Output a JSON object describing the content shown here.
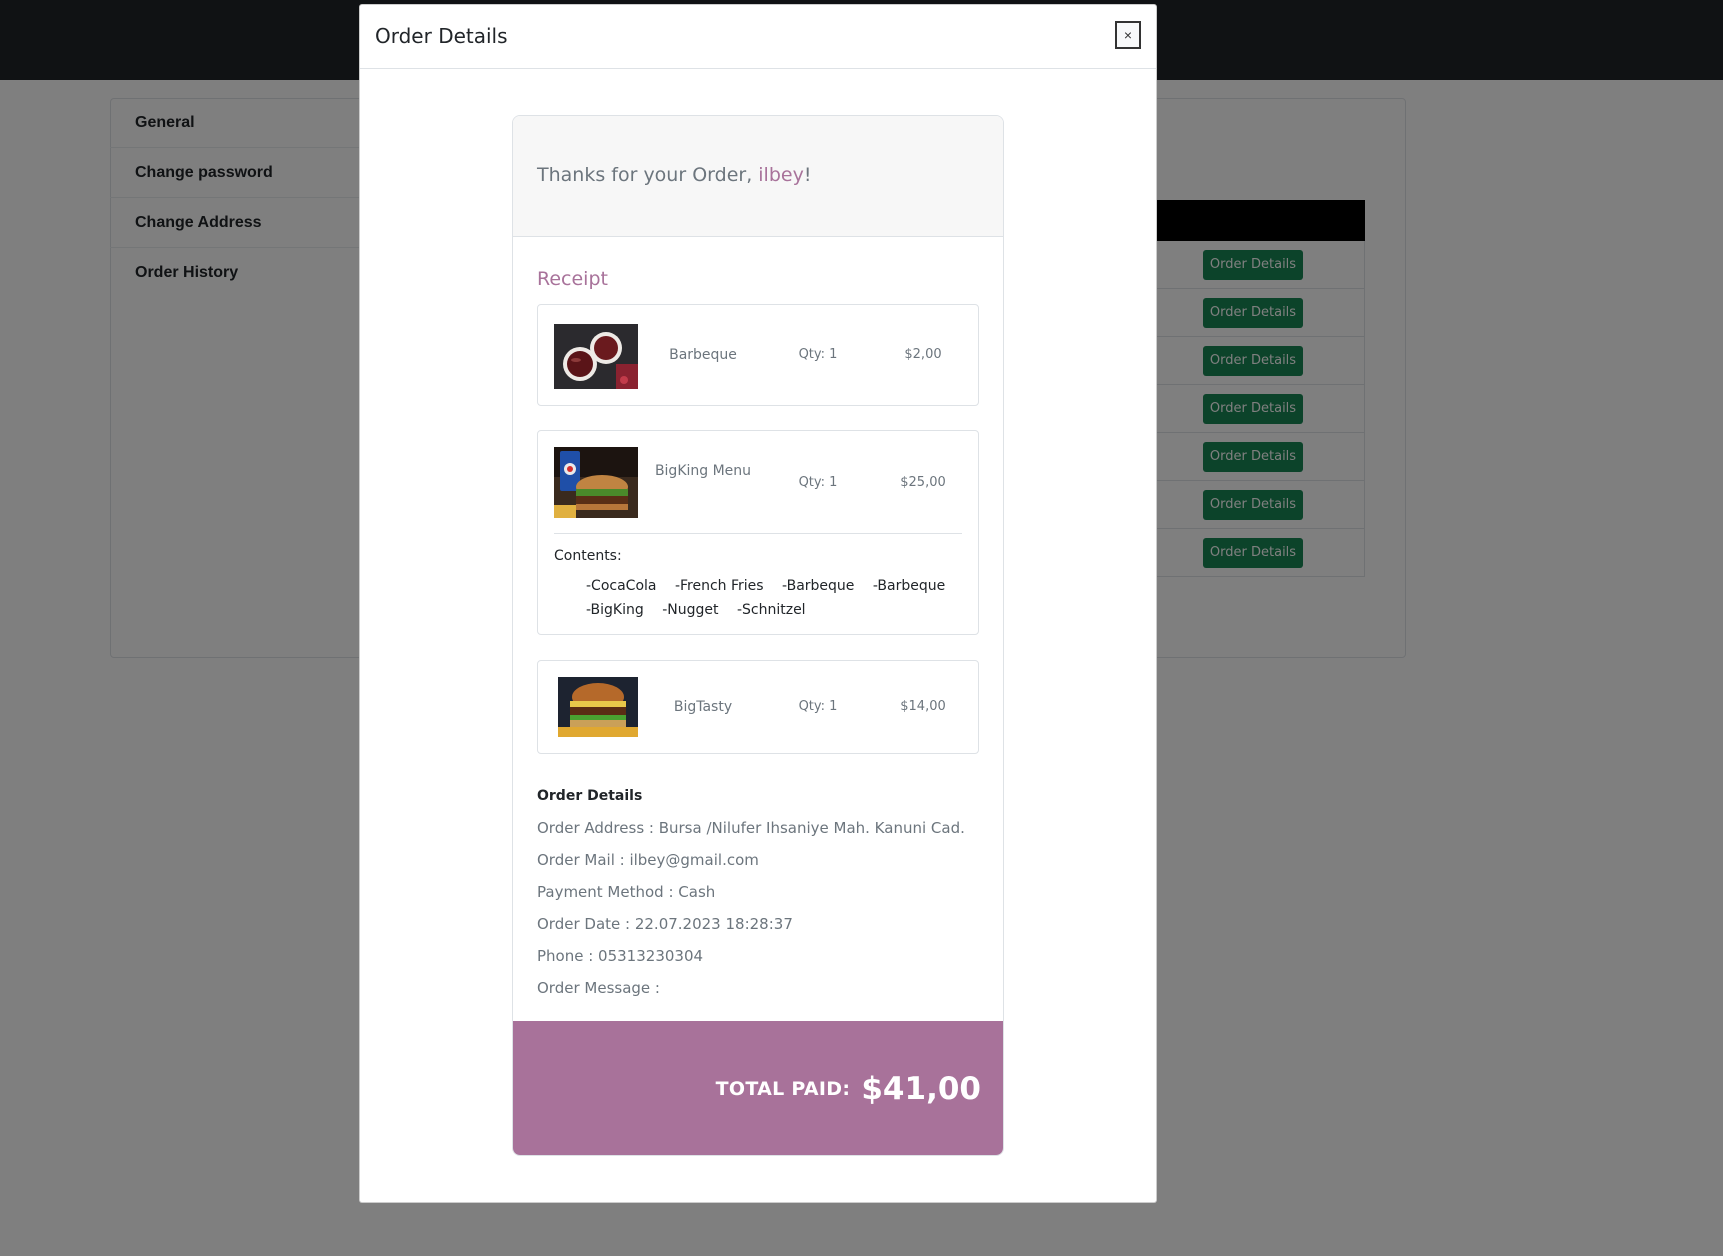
{
  "sidebar": {
    "items": [
      {
        "label": "General"
      },
      {
        "label": "Change password"
      },
      {
        "label": "Change Address"
      },
      {
        "label": "Order History"
      }
    ]
  },
  "order_table": {
    "button_label": "Order Details",
    "row_count": 7
  },
  "modal": {
    "title": "Order Details",
    "close_label": "×",
    "thanks_prefix": "Thanks for your Order, ",
    "user_name": "ilbey",
    "thanks_suffix": "!",
    "receipt_title": "Receipt",
    "items": [
      {
        "name": "Barbeque",
        "qty": "Qty: 1",
        "price": "$2,00",
        "image": "barbeque-sauce-image"
      },
      {
        "name": "BigKing Menu",
        "qty": "Qty: 1",
        "price": "$25,00",
        "image": "bigking-menu-image",
        "contents_label": "Contents:",
        "contents": [
          "-CocaCola",
          "-French Fries",
          "-Barbeque",
          "-Barbeque",
          "-BigKing",
          "-Nugget",
          "-Schnitzel"
        ]
      },
      {
        "name": "BigTasty",
        "qty": "Qty: 1",
        "price": "$14,00",
        "image": "bigtasty-burger-image"
      }
    ],
    "details": {
      "heading": "Order Details",
      "address": "Order Address : Bursa /Nilufer Ihsaniye Mah. Kanuni Cad.",
      "mail": "Order Mail : ilbey@gmail.com",
      "payment": "Payment Method : Cash",
      "date": "Order Date : 22.07.2023 18:28:37",
      "phone": "Phone : 05313230304",
      "message": "Order Message :"
    },
    "total_label": "TOTAL PAID:",
    "total_amount": "$41,00"
  },
  "colors": {
    "accent": "#a8729a",
    "button": "#198754",
    "header": "#212529"
  }
}
